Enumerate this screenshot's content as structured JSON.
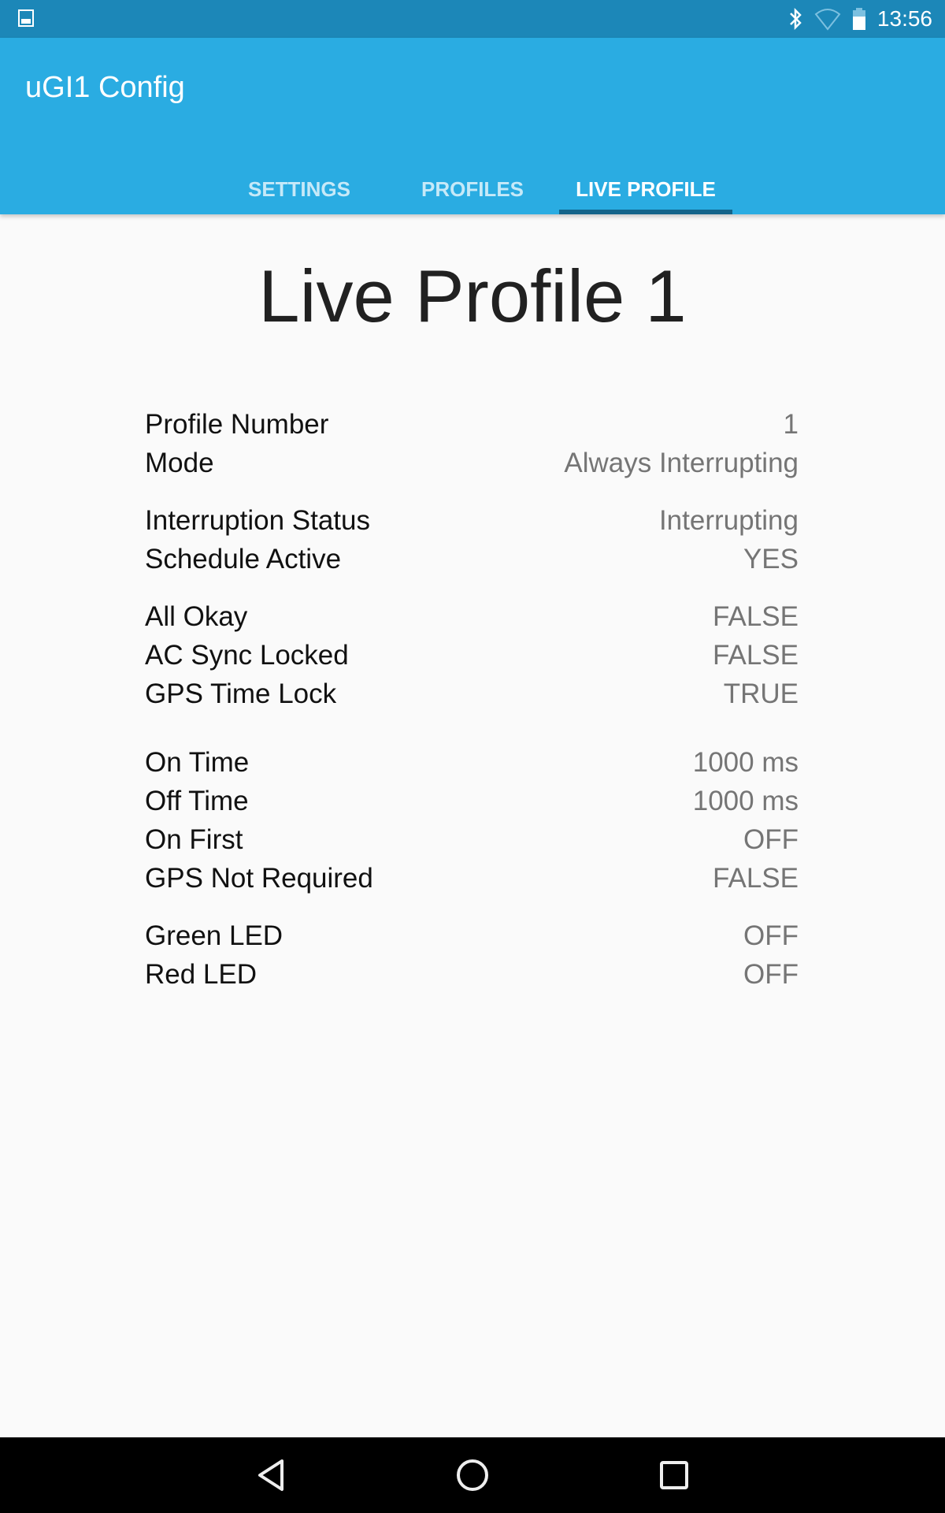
{
  "status_bar": {
    "time": "13:56",
    "icons": [
      "gallery-notification-icon",
      "bluetooth-icon",
      "wifi-icon",
      "battery-icon"
    ]
  },
  "app": {
    "title": "uGI1 Config"
  },
  "tabs": [
    {
      "label": "SETTINGS",
      "active": false
    },
    {
      "label": "PROFILES",
      "active": false
    },
    {
      "label": "LIVE PROFILE",
      "active": true
    }
  ],
  "page": {
    "title": "Live Profile 1"
  },
  "rows": [
    {
      "label": "Profile Number",
      "value": "1"
    },
    {
      "label": "Mode",
      "value": "Always Interrupting"
    },
    {
      "label": "Interruption Status",
      "value": "Interrupting"
    },
    {
      "label": "Schedule Active",
      "value": "YES"
    },
    {
      "label": "All Okay",
      "value": "FALSE"
    },
    {
      "label": "AC Sync Locked",
      "value": "FALSE"
    },
    {
      "label": "GPS Time Lock",
      "value": "TRUE"
    },
    {
      "label": "On Time",
      "value": "1000 ms"
    },
    {
      "label": "Off Time",
      "value": "1000 ms"
    },
    {
      "label": "On First",
      "value": "OFF"
    },
    {
      "label": "GPS Not Required",
      "value": "FALSE"
    },
    {
      "label": "Green LED",
      "value": "OFF"
    },
    {
      "label": "Red LED",
      "value": "OFF"
    }
  ],
  "nav_bar": {
    "buttons": [
      "back",
      "home",
      "recents"
    ]
  },
  "colors": {
    "status_bar": "#1c87b8",
    "toolbar": "#2aace2",
    "tab_indicator": "#13648a",
    "background": "#fafafa"
  }
}
